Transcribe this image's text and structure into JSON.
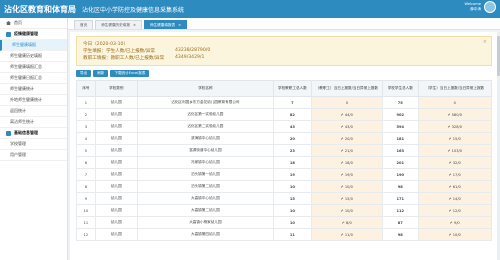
{
  "header": {
    "logo": "沾化区教育和体育局",
    "system_title": "沾化区中小学防控及健康信息采集系统",
    "welcome": "Welcome",
    "username": "薛中涛"
  },
  "sidebar": {
    "home": "首页",
    "group1": "疫情健康管理",
    "items": [
      "师生健康填报",
      "师生健康历史填报",
      "师生健康填报汇总",
      "师生健康日报汇总",
      "师生健康统计",
      "外地师生健康统计",
      "返回统计",
      "离沾师生统计"
    ],
    "group2": "基础信息管理",
    "items2": [
      "学校管理",
      "用户管理"
    ]
  },
  "tabs": [
    "首页",
    "师生健康历史填报",
    "师生健康填报表"
  ],
  "notice": {
    "today": "今日（2020-03-10）",
    "student_label": "学生填报：学生人数/已上报数/异常",
    "student_value": "43238/28790/0",
    "staff_label": "教职工填报：教职工人数/已上报数/异常",
    "staff_value": "4349/3429/1",
    "close": "×"
  },
  "buttons": [
    "导出",
    "刷新",
    "下载统计Excel报表"
  ],
  "table": {
    "headers": [
      "序号",
      "学校类别",
      "学校名称",
      "学校教职工总人数",
      "（教职工）当日上报数/当日异常上报数",
      "学校学生总人数",
      "（学生）当日上报数/当日异常上报数"
    ],
    "rows": [
      [
        "1",
        "幼儿园",
        "沾化区利国乡东方金花幼儿园教育有限公司",
        "7",
        "0",
        "75",
        "0"
      ],
      [
        "2",
        "幼儿园",
        "沾化区第一实验幼儿园",
        "82",
        "44/0",
        "902",
        "580/0"
      ],
      [
        "3",
        "幼儿园",
        "沾化区第二实验幼儿园",
        "43",
        "43/0",
        "594",
        "328/0"
      ],
      [
        "4",
        "幼儿园",
        "滨海镇中心幼儿园",
        "20",
        "20/0",
        "181",
        "15/0"
      ],
      [
        "5",
        "幼儿园",
        "富源街道中心幼儿园",
        "23",
        "21/0",
        "163",
        "103/0"
      ],
      [
        "6",
        "幼儿园",
        "冯家镇中心幼儿园",
        "18",
        "18/0",
        "201",
        "32/0"
      ],
      [
        "7",
        "幼儿园",
        "泊头镇第一幼儿园",
        "19",
        "19/0",
        "190",
        "17/0"
      ],
      [
        "8",
        "幼儿园",
        "泊头镇第二幼儿园",
        "10",
        "10/0",
        "98",
        "61/0"
      ],
      [
        "9",
        "幼儿园",
        "大高镇中心幼儿园",
        "15",
        "15/0",
        "171",
        "14/0"
      ],
      [
        "10",
        "幼儿园",
        "大高镇第二幼儿园",
        "10",
        "10/0",
        "112",
        "12/0"
      ],
      [
        "11",
        "幼儿园",
        "大高镇小杨家幼儿园",
        "10",
        "8/0",
        "87",
        "9/0"
      ],
      [
        "12",
        "幼儿园",
        "大高镇第四幼儿园",
        "11",
        "11/0",
        "98",
        "10/0"
      ]
    ]
  }
}
